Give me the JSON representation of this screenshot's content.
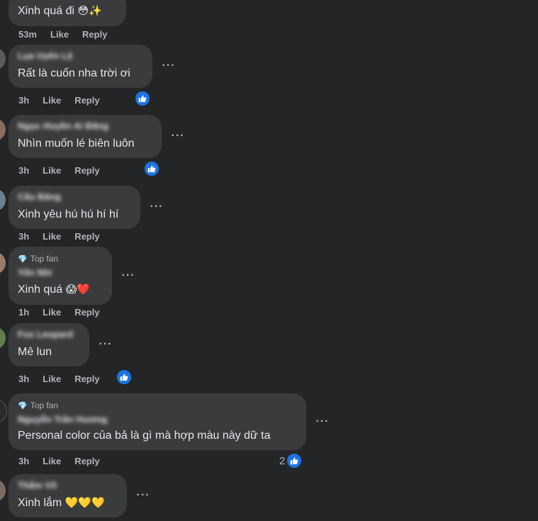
{
  "labels": {
    "like": "Like",
    "reply": "Reply",
    "top_fan": "Top fan"
  },
  "comments": [
    {
      "name": "",
      "text": "Xinh quá đi",
      "emojis": "😳✨",
      "time": "53m",
      "reactions": ""
    },
    {
      "name": "Lụa Uyên Lệ",
      "text": "Rất là cuốn nha trời ơi",
      "emojis": "",
      "time": "3h",
      "reactions": ""
    },
    {
      "name": "Ngọc Huyền Ai Đăng",
      "text": "Nhìn muốn lé biên luôn",
      "emojis": "",
      "time": "3h",
      "reactions": ""
    },
    {
      "name": "Cẩu Băng",
      "text": "Xinh yêu hú hú hí hí",
      "emojis": "",
      "time": "3h",
      "reactions": ""
    },
    {
      "name": "Yến Nhi",
      "text": "Xinh quá",
      "emojis": "😱❤️",
      "time": "1h",
      "reactions": "",
      "top_fan": true
    },
    {
      "name": "Fox Leopard",
      "text": "Mê lun",
      "emojis": "",
      "time": "3h",
      "reactions": ""
    },
    {
      "name": "Nguyễn Trần Hương",
      "text": "Personal color của bả là gì mà hợp màu này dữ ta",
      "emojis": "",
      "time": "3h",
      "reactions": "2",
      "top_fan": true
    },
    {
      "name": "Thắm Võ",
      "text": "Xinh lắm",
      "emojis": "💛💛💛",
      "time": "",
      "reactions": ""
    }
  ],
  "colors": {
    "background": "#242526",
    "bubble": "#3a3b3c",
    "text": "#e4e6eb",
    "secondary_text": "#b0b3b8",
    "like_blue": "#1b74e4"
  },
  "icons": [
    "more-options-icon",
    "like-reaction-icon",
    "top-fan-diamond-icon",
    "avatar"
  ]
}
